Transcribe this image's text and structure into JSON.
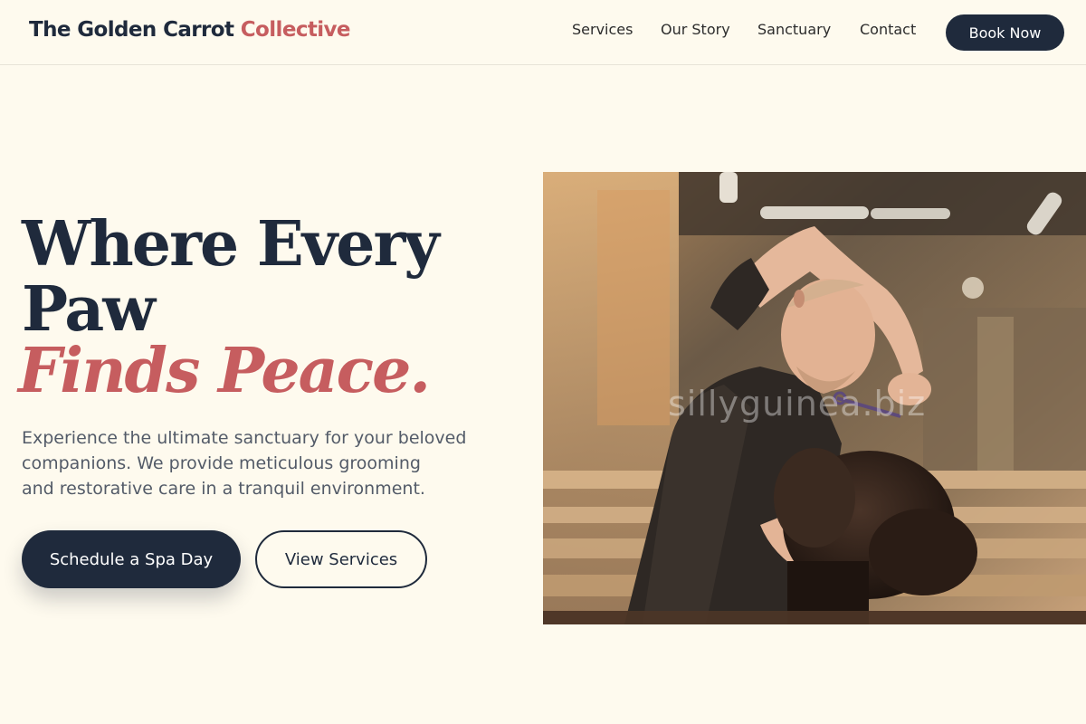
{
  "header": {
    "brand_main": "The Golden Carrot ",
    "brand_accent": "Collective",
    "nav": [
      "Services",
      "Our Story",
      "Sanctuary",
      "Contact"
    ],
    "book_label": "Book Now"
  },
  "hero": {
    "title_line1": "Where Every",
    "title_line2": "Paw",
    "title_line3": "Finds Peace.",
    "description": [
      "Experience the ultimate sanctuary for your beloved",
      "companions. We provide meticulous grooming",
      "and restorative care in a tranquil environment."
    ],
    "primary_button": "Schedule a Spa Day",
    "secondary_button": "View Services",
    "image_watermark": "sillyguinea.biz"
  },
  "colors": {
    "background": "#fefaee",
    "navy": "#1f2a3c",
    "accent": "#c65d5f",
    "body_text": "#535b68"
  }
}
